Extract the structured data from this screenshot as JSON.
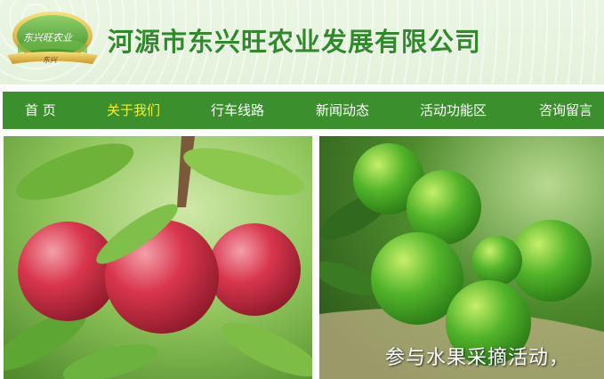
{
  "header": {
    "site_title": "河源市东兴旺农业发展有限公司"
  },
  "logo": {
    "badge_text": "东兴旺农业",
    "ribbon_text": "东兴"
  },
  "nav": {
    "items": [
      {
        "label": "首 页",
        "active": false
      },
      {
        "label": "关于我们",
        "active": true
      },
      {
        "label": "行车线路",
        "active": false
      },
      {
        "label": "新闻动态",
        "active": false
      },
      {
        "label": "活动功能区",
        "active": false
      },
      {
        "label": "咨询留言",
        "active": false
      }
    ]
  },
  "banner": {
    "caption": "参与水果采摘活动，"
  },
  "colors": {
    "nav_bg": "#3b8f2c",
    "nav_active": "#f7f02a",
    "title_green": "#2f8a2a"
  }
}
